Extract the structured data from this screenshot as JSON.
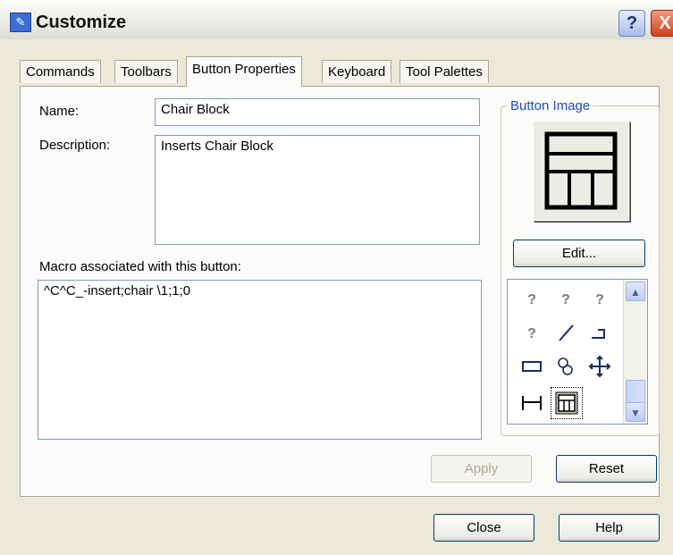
{
  "window": {
    "title": "Customize",
    "help_glyph": "?",
    "close_glyph": "X"
  },
  "tabs": [
    {
      "label": "Commands"
    },
    {
      "label": "Toolbars"
    },
    {
      "label": "Button Properties",
      "active": true
    },
    {
      "label": "Keyboard"
    },
    {
      "label": "Tool Palettes"
    }
  ],
  "form": {
    "name_label": "Name:",
    "name_value": "Chair Block",
    "description_label": "Description:",
    "description_value": "Inserts Chair Block",
    "macro_label": "Macro associated with this button:",
    "macro_value": "^C^C_-insert;chair \\1;1;0"
  },
  "button_image": {
    "group_title": "Button Image",
    "edit_label": "Edit...",
    "palette_icons": [
      "help-icon",
      "help-icon",
      "help-icon",
      "help-icon",
      "line-icon",
      "polyline-icon",
      "rectangle-icon",
      "revcloud-icon",
      "move-icon",
      "dimension-icon",
      "chair-block-icon"
    ]
  },
  "actions": {
    "apply_label": "Apply",
    "reset_label": "Reset",
    "close_label": "Close",
    "help_label": "Help"
  },
  "colors": {
    "group_title": "#1f4fb5",
    "title_close": "#d2401c"
  }
}
